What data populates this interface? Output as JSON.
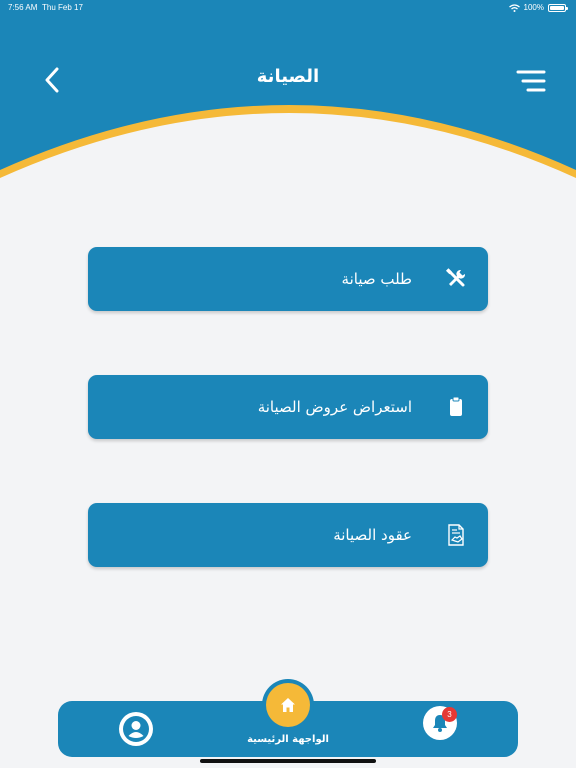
{
  "status_bar": {
    "time": "7:56 AM",
    "date": "Thu Feb 17",
    "battery": "100%"
  },
  "header": {
    "title": "الصيانة"
  },
  "menu": {
    "items": [
      {
        "label": "طلب صيانة",
        "icon": "tools-icon"
      },
      {
        "label": "استعراض عروض الصيانة",
        "icon": "clipboard-icon"
      },
      {
        "label": "عقود الصيانة",
        "icon": "contract-handshake-icon"
      }
    ]
  },
  "bottom_nav": {
    "home_label": "الواجهة الرئيسية",
    "notification_count": "3"
  },
  "colors": {
    "primary": "#1b86b8",
    "accent": "#f5b938",
    "background": "#f3f4f6",
    "badge": "#e53935"
  }
}
